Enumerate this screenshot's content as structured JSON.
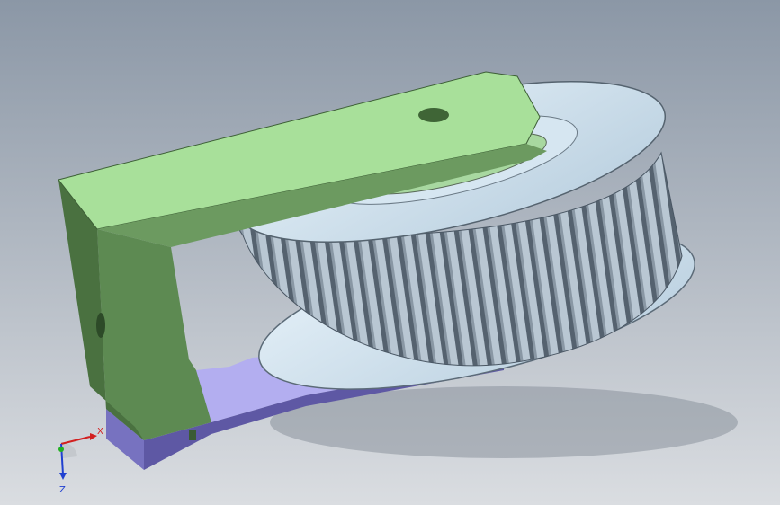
{
  "viewport": {
    "background_top": "#8b97a6",
    "background_bottom": "#dadde1"
  },
  "model": {
    "bracket_color": "#9cd18f",
    "bracket_side_color": "#4f7d46",
    "base_color": "#a7a2e8",
    "base_side_color": "#5a559c",
    "pulley_color": "#cfe2ef",
    "pulley_tooth_color": "#6c7a88"
  },
  "triad": {
    "x_label": "X",
    "z_label": "Z",
    "x_color": "#d22020",
    "y_color": "#22b022",
    "z_color": "#2040d0"
  }
}
